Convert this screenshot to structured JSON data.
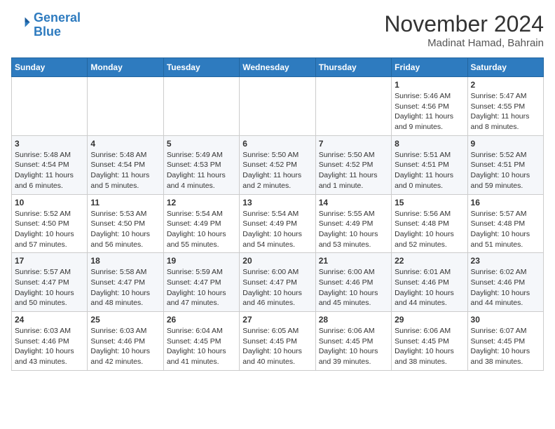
{
  "header": {
    "logo_line1": "General",
    "logo_line2": "Blue",
    "month": "November 2024",
    "location": "Madinat Hamad, Bahrain"
  },
  "weekdays": [
    "Sunday",
    "Monday",
    "Tuesday",
    "Wednesday",
    "Thursday",
    "Friday",
    "Saturday"
  ],
  "weeks": [
    [
      {
        "day": "",
        "text": ""
      },
      {
        "day": "",
        "text": ""
      },
      {
        "day": "",
        "text": ""
      },
      {
        "day": "",
        "text": ""
      },
      {
        "day": "",
        "text": ""
      },
      {
        "day": "1",
        "text": "Sunrise: 5:46 AM\nSunset: 4:56 PM\nDaylight: 11 hours and 9 minutes."
      },
      {
        "day": "2",
        "text": "Sunrise: 5:47 AM\nSunset: 4:55 PM\nDaylight: 11 hours and 8 minutes."
      }
    ],
    [
      {
        "day": "3",
        "text": "Sunrise: 5:48 AM\nSunset: 4:54 PM\nDaylight: 11 hours and 6 minutes."
      },
      {
        "day": "4",
        "text": "Sunrise: 5:48 AM\nSunset: 4:54 PM\nDaylight: 11 hours and 5 minutes."
      },
      {
        "day": "5",
        "text": "Sunrise: 5:49 AM\nSunset: 4:53 PM\nDaylight: 11 hours and 4 minutes."
      },
      {
        "day": "6",
        "text": "Sunrise: 5:50 AM\nSunset: 4:52 PM\nDaylight: 11 hours and 2 minutes."
      },
      {
        "day": "7",
        "text": "Sunrise: 5:50 AM\nSunset: 4:52 PM\nDaylight: 11 hours and 1 minute."
      },
      {
        "day": "8",
        "text": "Sunrise: 5:51 AM\nSunset: 4:51 PM\nDaylight: 11 hours and 0 minutes."
      },
      {
        "day": "9",
        "text": "Sunrise: 5:52 AM\nSunset: 4:51 PM\nDaylight: 10 hours and 59 minutes."
      }
    ],
    [
      {
        "day": "10",
        "text": "Sunrise: 5:52 AM\nSunset: 4:50 PM\nDaylight: 10 hours and 57 minutes."
      },
      {
        "day": "11",
        "text": "Sunrise: 5:53 AM\nSunset: 4:50 PM\nDaylight: 10 hours and 56 minutes."
      },
      {
        "day": "12",
        "text": "Sunrise: 5:54 AM\nSunset: 4:49 PM\nDaylight: 10 hours and 55 minutes."
      },
      {
        "day": "13",
        "text": "Sunrise: 5:54 AM\nSunset: 4:49 PM\nDaylight: 10 hours and 54 minutes."
      },
      {
        "day": "14",
        "text": "Sunrise: 5:55 AM\nSunset: 4:49 PM\nDaylight: 10 hours and 53 minutes."
      },
      {
        "day": "15",
        "text": "Sunrise: 5:56 AM\nSunset: 4:48 PM\nDaylight: 10 hours and 52 minutes."
      },
      {
        "day": "16",
        "text": "Sunrise: 5:57 AM\nSunset: 4:48 PM\nDaylight: 10 hours and 51 minutes."
      }
    ],
    [
      {
        "day": "17",
        "text": "Sunrise: 5:57 AM\nSunset: 4:47 PM\nDaylight: 10 hours and 50 minutes."
      },
      {
        "day": "18",
        "text": "Sunrise: 5:58 AM\nSunset: 4:47 PM\nDaylight: 10 hours and 48 minutes."
      },
      {
        "day": "19",
        "text": "Sunrise: 5:59 AM\nSunset: 4:47 PM\nDaylight: 10 hours and 47 minutes."
      },
      {
        "day": "20",
        "text": "Sunrise: 6:00 AM\nSunset: 4:47 PM\nDaylight: 10 hours and 46 minutes."
      },
      {
        "day": "21",
        "text": "Sunrise: 6:00 AM\nSunset: 4:46 PM\nDaylight: 10 hours and 45 minutes."
      },
      {
        "day": "22",
        "text": "Sunrise: 6:01 AM\nSunset: 4:46 PM\nDaylight: 10 hours and 44 minutes."
      },
      {
        "day": "23",
        "text": "Sunrise: 6:02 AM\nSunset: 4:46 PM\nDaylight: 10 hours and 44 minutes."
      }
    ],
    [
      {
        "day": "24",
        "text": "Sunrise: 6:03 AM\nSunset: 4:46 PM\nDaylight: 10 hours and 43 minutes."
      },
      {
        "day": "25",
        "text": "Sunrise: 6:03 AM\nSunset: 4:46 PM\nDaylight: 10 hours and 42 minutes."
      },
      {
        "day": "26",
        "text": "Sunrise: 6:04 AM\nSunset: 4:45 PM\nDaylight: 10 hours and 41 minutes."
      },
      {
        "day": "27",
        "text": "Sunrise: 6:05 AM\nSunset: 4:45 PM\nDaylight: 10 hours and 40 minutes."
      },
      {
        "day": "28",
        "text": "Sunrise: 6:06 AM\nSunset: 4:45 PM\nDaylight: 10 hours and 39 minutes."
      },
      {
        "day": "29",
        "text": "Sunrise: 6:06 AM\nSunset: 4:45 PM\nDaylight: 10 hours and 38 minutes."
      },
      {
        "day": "30",
        "text": "Sunrise: 6:07 AM\nSunset: 4:45 PM\nDaylight: 10 hours and 38 minutes."
      }
    ]
  ]
}
